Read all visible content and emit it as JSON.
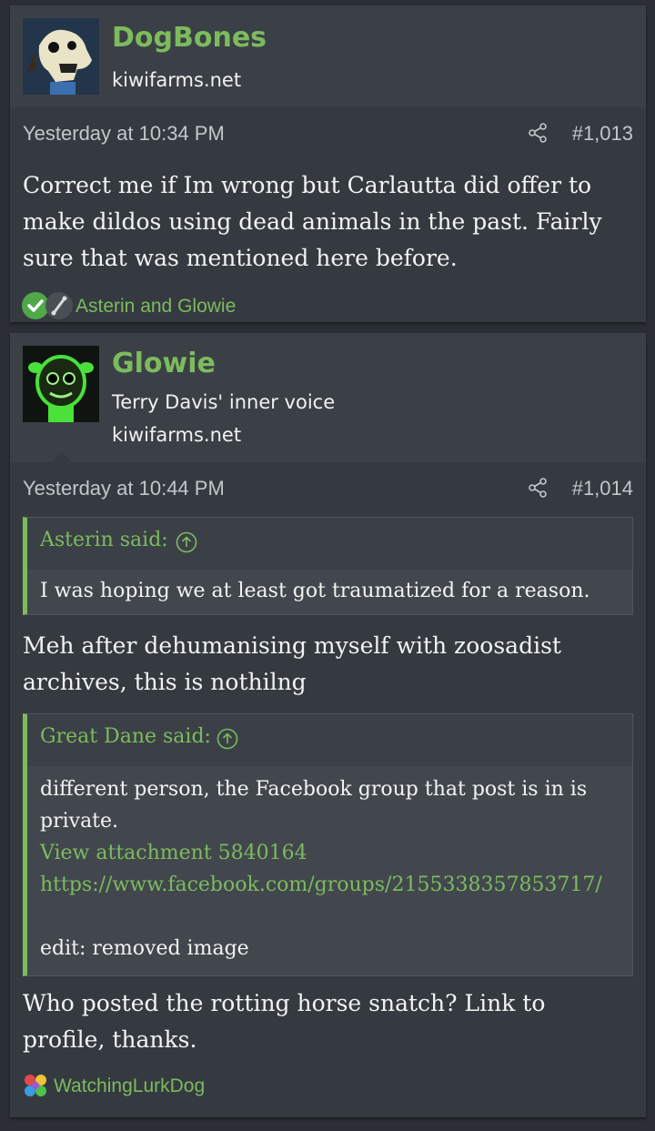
{
  "posts": [
    {
      "username": "DogBones",
      "subtitles": [
        "kiwifarms.net"
      ],
      "date": "Yesterday at 10:34 PM",
      "post_number": "#1,013",
      "content": "Correct me if Im wrong but Carlautta did offer to make dildos using dead animals in the past. Fairly sure that was mentioned here before.",
      "reactions": [
        "check-react-icon",
        "bone-react-icon"
      ],
      "reaction_names": "Asterin and Glowie"
    },
    {
      "username": "Glowie",
      "subtitles": [
        "Terry Davis' inner voice",
        "kiwifarms.net"
      ],
      "date": "Yesterday at 10:44 PM",
      "post_number": "#1,014",
      "quote1": {
        "author": "Asterin said:",
        "text": "I was hoping we at least got traumatized for a reason."
      },
      "content1": "Meh after dehumanising myself with zoosadist archives, this is nothilng",
      "quote2": {
        "author": "Great Dane said:",
        "text": "different person, the Facebook group that post is in is private.",
        "attachment": "View attachment 5840164",
        "url": "https://www.facebook.com/groups/2155338357853717/",
        "edit": "edit: removed image"
      },
      "content2": "Who posted the rotting horse snatch? Link to profile, thanks.",
      "reaction_names": "WatchingLurkDog"
    }
  ],
  "colors": {
    "accent": "#7dbb5d",
    "background": "#2b2f35",
    "post": "#353a41"
  }
}
